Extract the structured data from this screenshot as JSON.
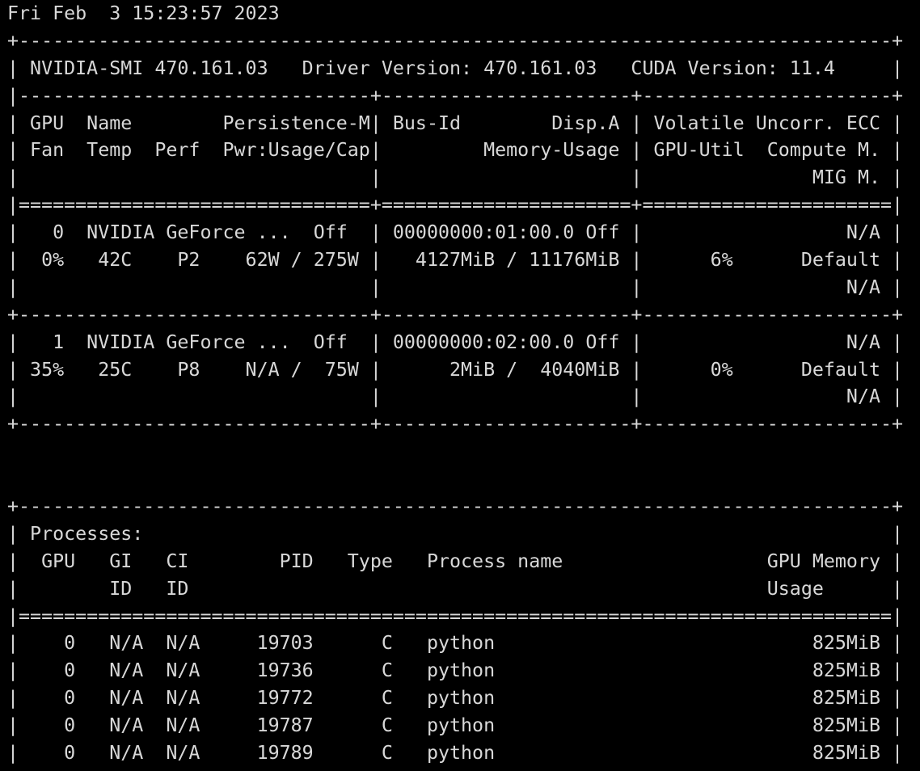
{
  "terminal": {
    "colors": {
      "background": "#000000",
      "foreground": "#d8d8d8"
    },
    "lines": [
      "Fri Feb  3 15:23:57 2023",
      "+-----------------------------------------------------------------------------+",
      "| NVIDIA-SMI 470.161.03   Driver Version: 470.161.03   CUDA Version: 11.4     |",
      "|-------------------------------+----------------------+----------------------+",
      "| GPU  Name        Persistence-M| Bus-Id        Disp.A | Volatile Uncorr. ECC |",
      "| Fan  Temp  Perf  Pwr:Usage/Cap|         Memory-Usage | GPU-Util  Compute M. |",
      "|                               |                      |               MIG M. |",
      "|===============================+======================+======================|",
      "|   0  NVIDIA GeForce ...  Off  | 00000000:01:00.0 Off |                  N/A |",
      "|  0%   42C    P2    62W / 275W |   4127MiB / 11176MiB |      6%      Default |",
      "|                               |                      |                  N/A |",
      "+-------------------------------+----------------------+----------------------+",
      "|   1  NVIDIA GeForce ...  Off  | 00000000:02:00.0 Off |                  N/A |",
      "| 35%   25C    P8    N/A /  75W |      2MiB /  4040MiB |      0%      Default |",
      "|                               |                      |                  N/A |",
      "+-------------------------------+----------------------+----------------------+",
      "",
      "",
      "+-----------------------------------------------------------------------------+",
      "| Processes:                                                                  |",
      "|  GPU   GI   CI        PID   Type   Process name                  GPU Memory |",
      "|        ID   ID                                                   Usage      |",
      "|=============================================================================|",
      "|    0   N/A  N/A     19703      C   python                            825MiB |",
      "|    0   N/A  N/A     19736      C   python                            825MiB |",
      "|    0   N/A  N/A     19772      C   python                            825MiB |",
      "|    0   N/A  N/A     19787      C   python                            825MiB |",
      "|    0   N/A  N/A     19789      C   python                            825MiB |",
      "+-----------------------------------------------------------------------------+"
    ]
  }
}
